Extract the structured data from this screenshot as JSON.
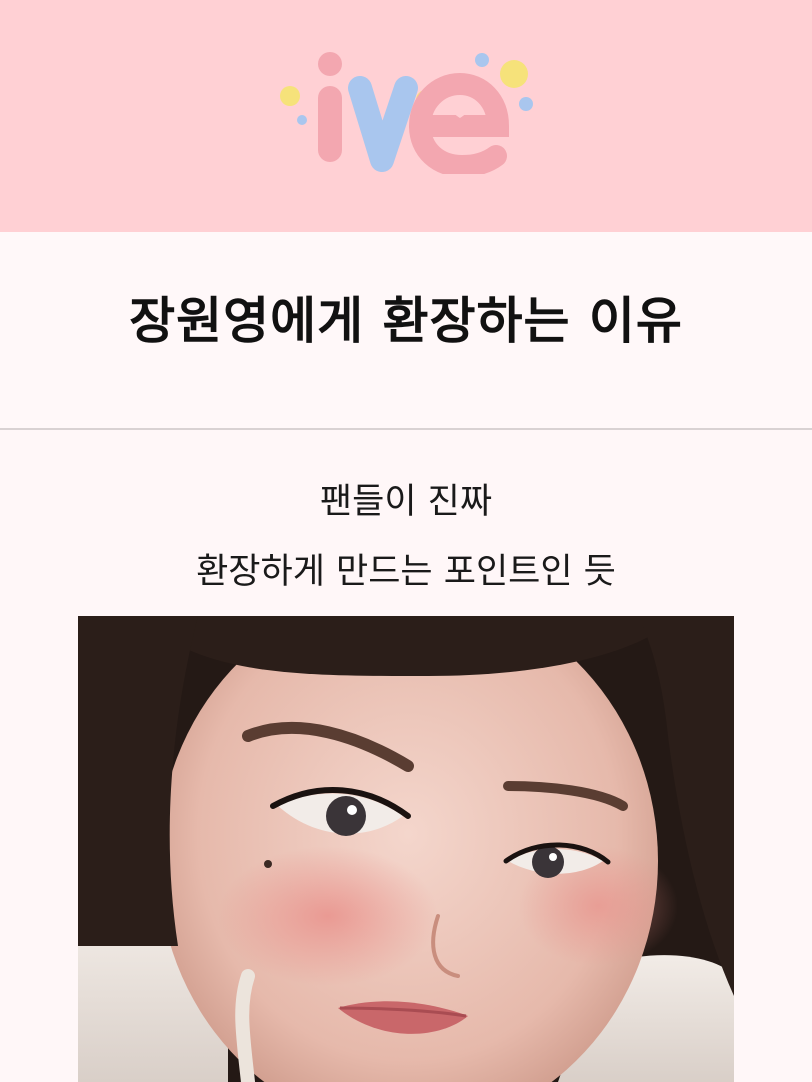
{
  "header": {
    "logo_text": "ive",
    "logo_colors": {
      "i": "#f3a7b0",
      "v": "#a9c6ee",
      "e": "#f3a7b0",
      "dot_yellow": "#f6e27a",
      "dot_blue": "#a9c6ee"
    },
    "background": "#ffd0d4"
  },
  "title": {
    "text": "장원영에게 환장하는 이유"
  },
  "caption": {
    "line1": "팬들이 진짜",
    "line2": "환장하게 만드는 포인트인 듯"
  },
  "photo": {
    "subject": "selfie-portrait"
  }
}
